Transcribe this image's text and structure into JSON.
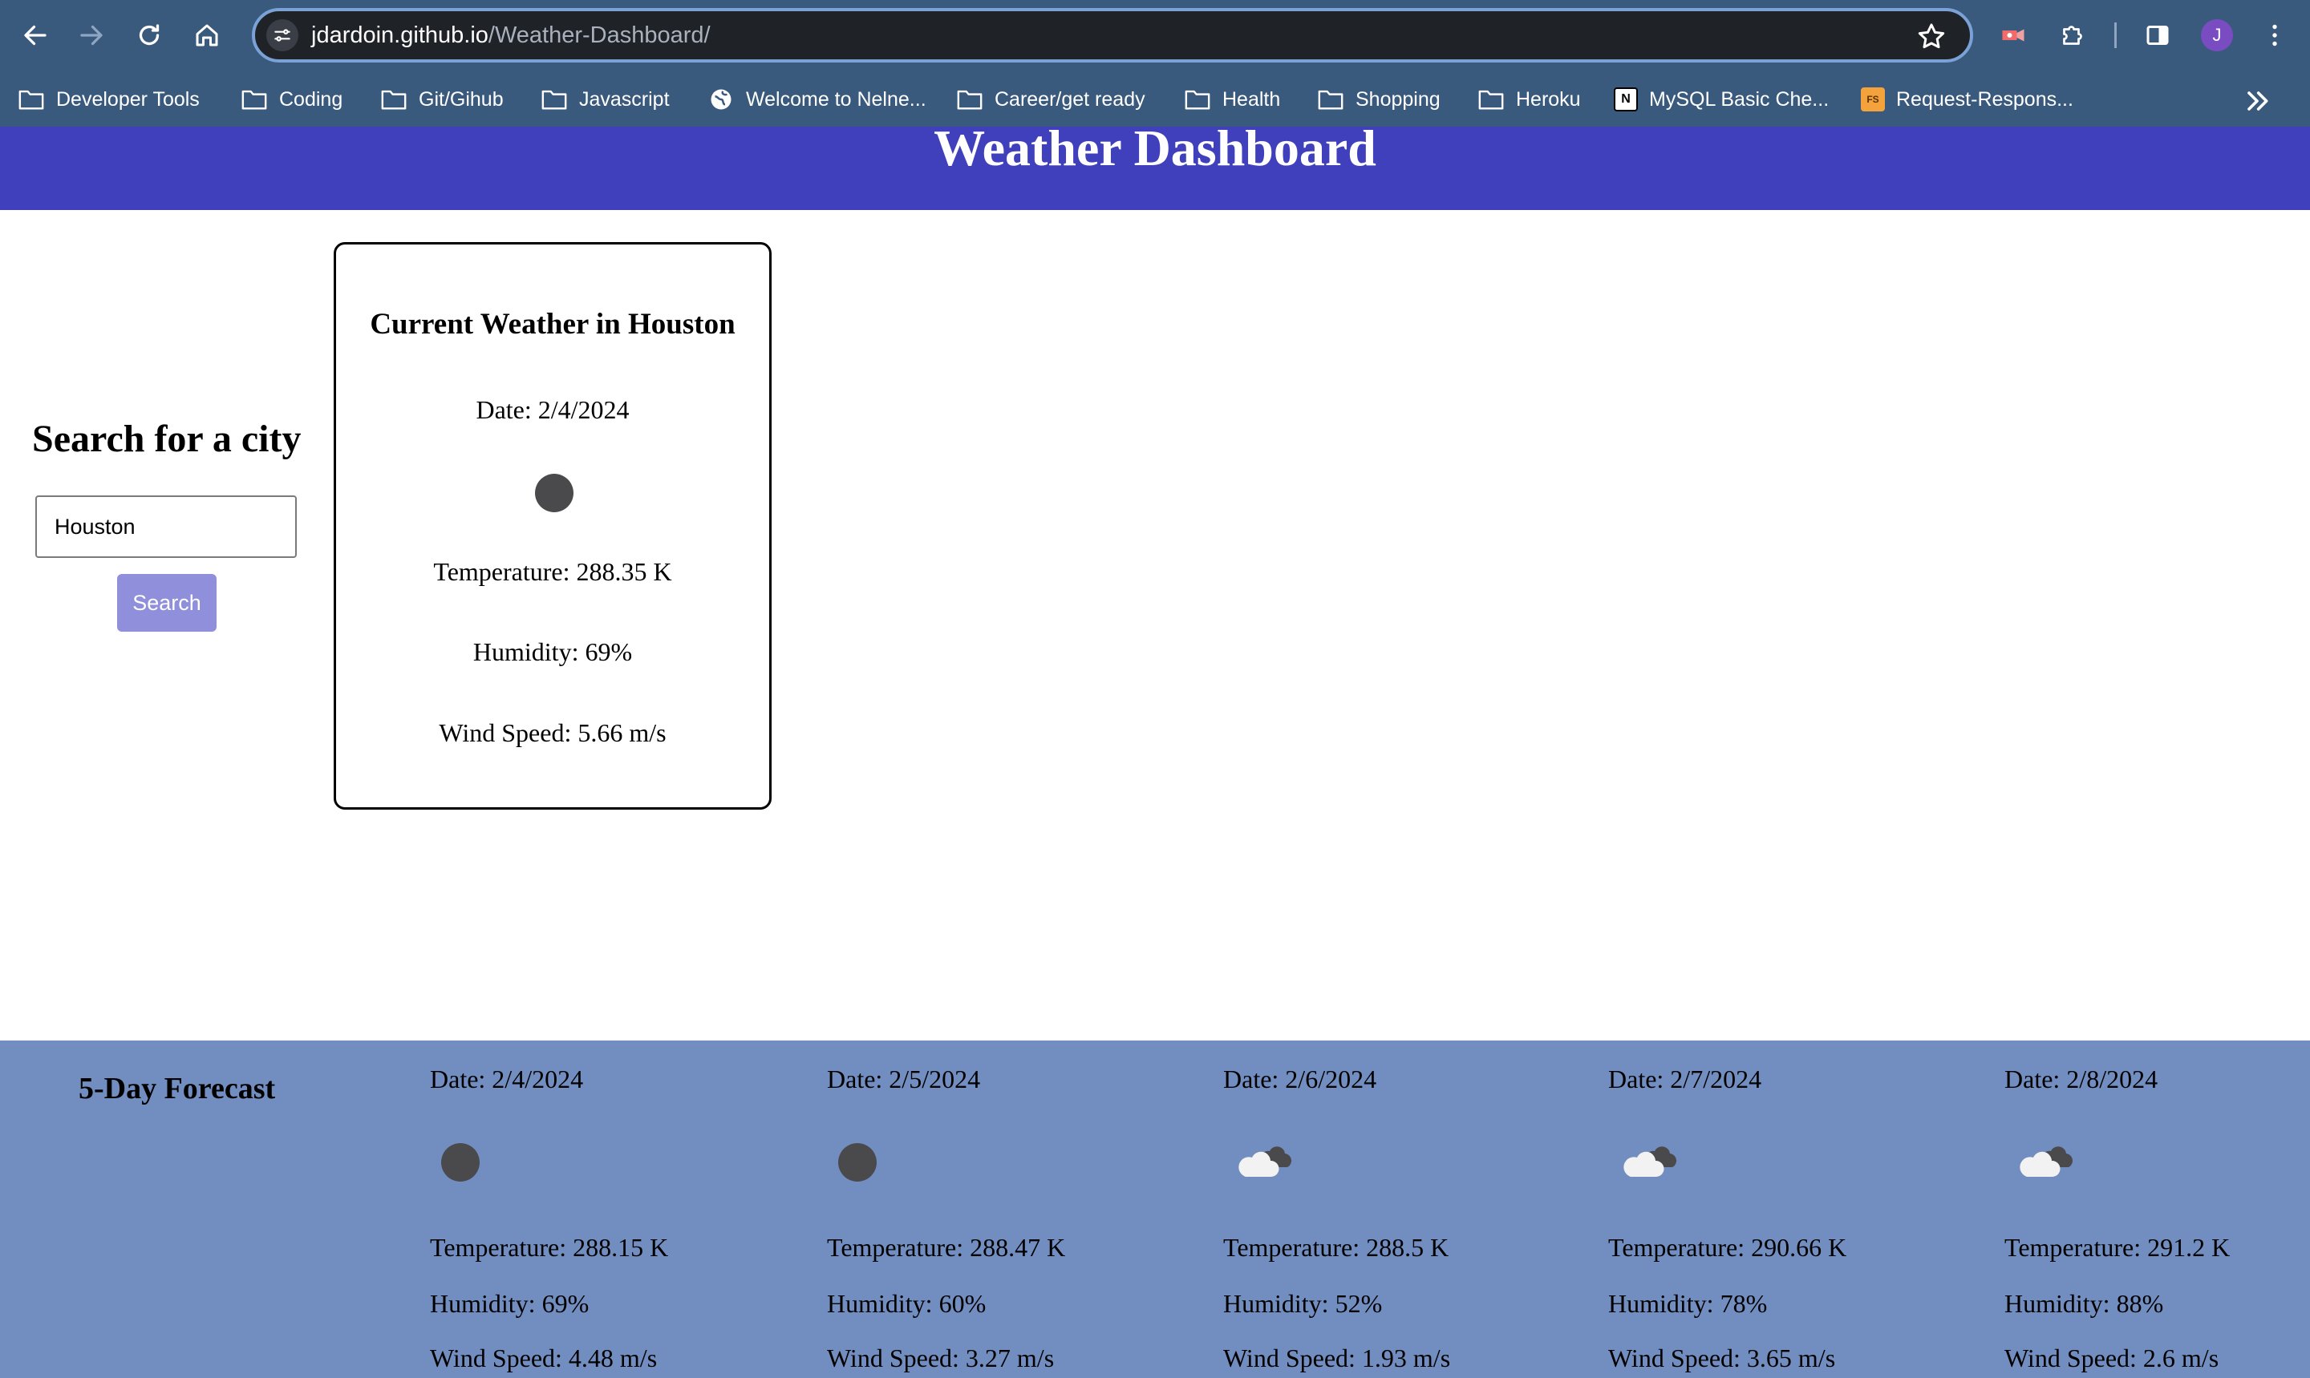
{
  "browser": {
    "url_host": "jdardoin.github.io",
    "url_path": "/Weather-Dashboard/",
    "avatar_letter": "J",
    "accent_color": "#3a5a7d",
    "bookmarks": [
      {
        "label": "Developer Tools",
        "icon": "folder-icon"
      },
      {
        "label": "Coding",
        "icon": "folder-icon"
      },
      {
        "label": "Git/Gihub",
        "icon": "folder-icon"
      },
      {
        "label": "Javascript",
        "icon": "folder-icon"
      },
      {
        "label": "Welcome to Nelne...",
        "icon": "globe-icon"
      },
      {
        "label": "Career/get ready",
        "icon": "folder-icon"
      },
      {
        "label": "Health",
        "icon": "folder-icon"
      },
      {
        "label": "Shopping",
        "icon": "folder-icon"
      },
      {
        "label": "Heroku",
        "icon": "folder-icon"
      },
      {
        "label": "MySQL Basic Che...",
        "icon": "notion-icon"
      },
      {
        "label": "Request-Respons...",
        "icon": "fs-icon"
      }
    ]
  },
  "page": {
    "title": "Weather Dashboard",
    "header_color": "#4040bd",
    "search": {
      "heading": "Search for a city",
      "input_value": "Houston",
      "button_label": "Search"
    },
    "current": {
      "title": "Current Weather in Houston",
      "date": "Date: 2/4/2024",
      "icon": "night-clear-icon",
      "temperature": "Temperature: 288.35 K",
      "humidity": "Humidity: 69%",
      "wind": "Wind Speed: 5.66 m/s"
    },
    "forecast": {
      "heading": "5-Day Forecast",
      "bg_color": "#728ec0",
      "days": [
        {
          "date": "Date: 2/4/2024",
          "icon": "night-clear-icon",
          "temperature": "Temperature: 288.15 K",
          "humidity": "Humidity: 69%",
          "wind": "Wind Speed: 4.48 m/s"
        },
        {
          "date": "Date: 2/5/2024",
          "icon": "night-clear-icon",
          "temperature": "Temperature: 288.47 K",
          "humidity": "Humidity: 60%",
          "wind": "Wind Speed: 3.27 m/s"
        },
        {
          "date": "Date: 2/6/2024",
          "icon": "broken-clouds-icon",
          "temperature": "Temperature: 288.5 K",
          "humidity": "Humidity: 52%",
          "wind": "Wind Speed: 1.93 m/s"
        },
        {
          "date": "Date: 2/7/2024",
          "icon": "broken-clouds-icon",
          "temperature": "Temperature: 290.66 K",
          "humidity": "Humidity: 78%",
          "wind": "Wind Speed: 3.65 m/s"
        },
        {
          "date": "Date: 2/8/2024",
          "icon": "broken-clouds-icon",
          "temperature": "Temperature: 291.2 K",
          "humidity": "Humidity: 88%",
          "wind": "Wind Speed: 2.6 m/s"
        }
      ]
    }
  }
}
